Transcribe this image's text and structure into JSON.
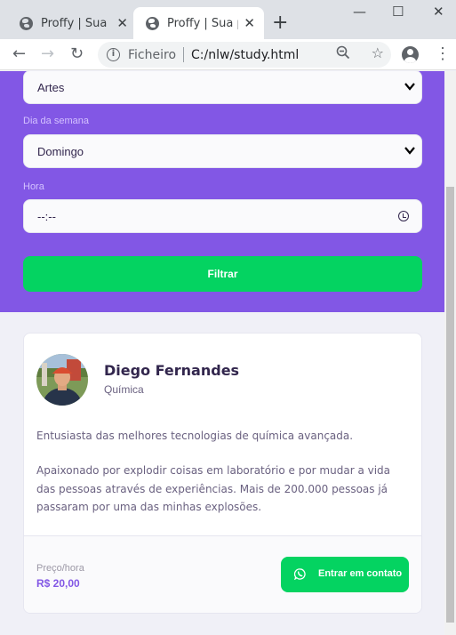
{
  "browser": {
    "tabs": [
      {
        "title": "Proffy | Sua pla",
        "icon": "globe-icon",
        "active": false
      },
      {
        "title": "Proffy | Sua pla",
        "icon": "globe-icon",
        "active": true
      }
    ],
    "new_tab_label": "+",
    "scheme": "Ficheiro",
    "url": "C:/nlw/study.html"
  },
  "filters": {
    "subject_value": "Artes",
    "weekday_label": "Dia da semana",
    "weekday_value": "Domingo",
    "time_label": "Hora",
    "time_value": "--:--",
    "submit_label": "Filtrar"
  },
  "teacher": {
    "name": "Diego Fernandes",
    "subject": "Química",
    "bio_paragraphs": [
      "Entusiasta das melhores tecnologias de química avançada.",
      "Apaixonado por explodir coisas em laboratório e por mudar a vida das pessoas através de experiências. Mais de 200.000 pessoas já passaram por uma das minhas explosões."
    ],
    "price_label": "Preço/hora",
    "price_value": "R$ 20,00",
    "contact_label": "Entrar em contato"
  },
  "colors": {
    "primary": "#8257e5",
    "secondary": "#04d361",
    "text_title": "#32264d",
    "text_base": "#6a6180",
    "background": "#f0f0f7"
  }
}
